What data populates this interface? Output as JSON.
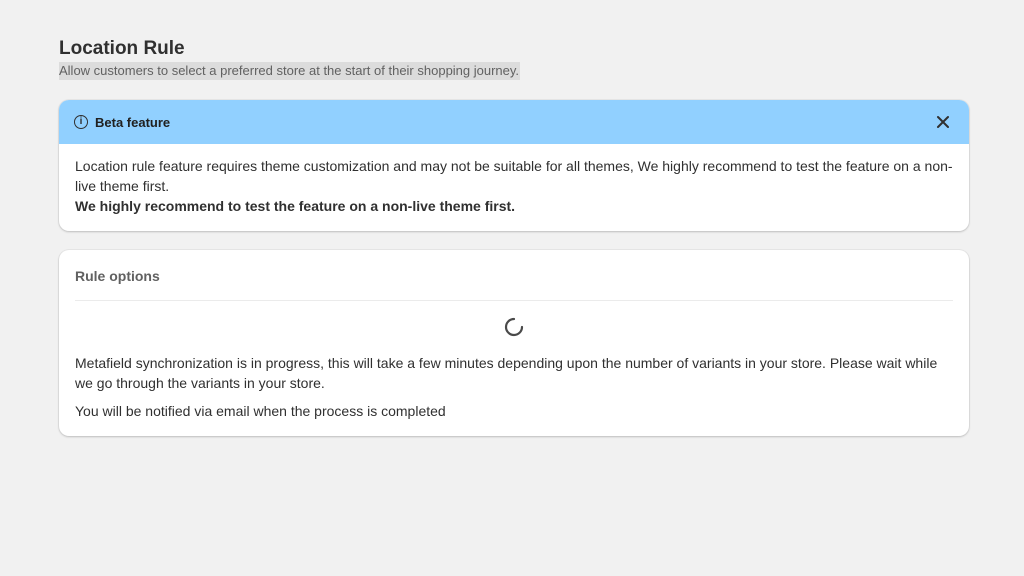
{
  "page": {
    "title": "Location Rule",
    "subtitle": "Allow customers to select a preferred store at the start of their shopping journey."
  },
  "banner": {
    "title": "Beta feature",
    "icon": "info-icon",
    "close_icon": "close-icon",
    "background_color": "#91d0ff",
    "body_text": "Location rule feature requires theme customization and may not be suitable for all themes, We highly recommend to test the feature on a non-live theme first.",
    "body_bold": "We highly recommend to test the feature on a non-live theme first."
  },
  "rule_options": {
    "title": "Rule options",
    "spinner_icon": "loading-spinner-icon",
    "message": "Metafield synchronization is in progress, this will take a few minutes depending upon the number of variants in your store. Please wait while we go through the variants in your store.",
    "notice": "You will be notified via email when the process is completed"
  }
}
